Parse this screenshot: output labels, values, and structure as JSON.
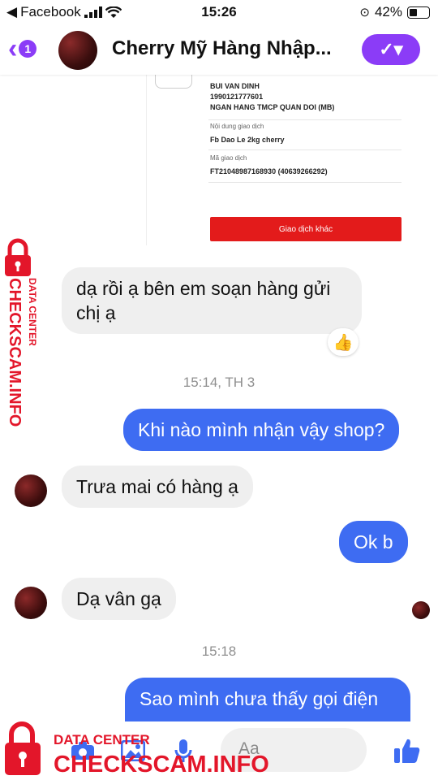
{
  "status_bar": {
    "back_app": "Facebook",
    "time": "15:26",
    "battery": "42%"
  },
  "header": {
    "back_badge": "1",
    "title": "Cherry Mỹ Hàng Nhập..."
  },
  "receipt": {
    "lines": [
      "BUI VAN DINH",
      "1990121777601",
      "NGAN HANG TMCP QUAN DOI (MB)"
    ],
    "content_label": "Nội dung giao dịch",
    "content_value": "Fb Dao Le 2kg cherry",
    "code_label": "Mã giao dịch",
    "code_value": "FT21048987168930 (40639266292)",
    "button": "Giao dịch khác"
  },
  "messages": [
    {
      "side": "in",
      "text": "dạ rồi ạ bên em soạn hàng gửi chị ạ",
      "reaction": "👍"
    },
    {
      "side": "ts",
      "text": "15:14, TH 3"
    },
    {
      "side": "out",
      "text": "Khi nào mình nhận vậy shop?"
    },
    {
      "side": "in",
      "text": "Trưa mai có hàng ạ"
    },
    {
      "side": "out",
      "text": "Ok b"
    },
    {
      "side": "in",
      "text": "Dạ vân gạ"
    },
    {
      "side": "ts",
      "text": "15:18"
    },
    {
      "side": "out",
      "text": "Sao mình chưa thấy gọi điện"
    }
  ],
  "composer": {
    "placeholder": "Aa",
    "icons": [
      "camera-icon",
      "photo-icon",
      "microphone-icon",
      "emoji-icon",
      "thumbs-up-icon"
    ]
  },
  "watermark": {
    "top": "DATA CENTER",
    "brand": "CHECKSCAM.INFO"
  },
  "colors": {
    "accent_purple": "#8b3cf7",
    "outgoing_bubble": "#3e6cf2",
    "incoming_bubble": "#efefef",
    "receipt_button": "#e31b1b",
    "watermark_red": "#e3162a"
  }
}
